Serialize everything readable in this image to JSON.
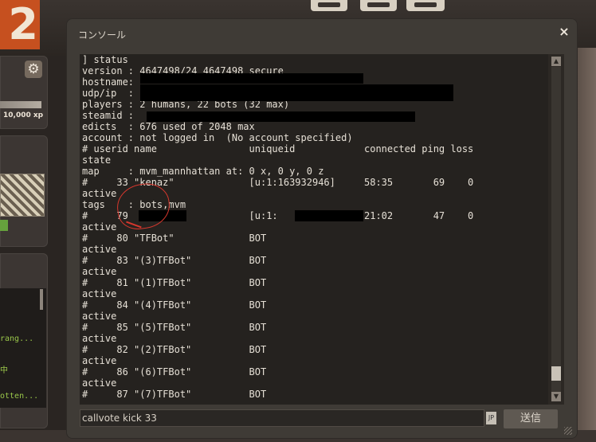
{
  "background": {
    "logo_text": "2",
    "xp_label": "10,000 xp",
    "gear_glyph": "⚙",
    "chat_lines": [
      "rang...",
      "中",
      "otten..."
    ]
  },
  "console": {
    "title": "コンソール",
    "close_glyph": "×",
    "lines": [
      "] status",
      "version : 4647498/24 4647498 secure",
      "hostname:",
      "udp/ip  :",
      "players : 2 humans, 22 bots (32 max)",
      "steamid :",
      "edicts  : 676 used of 2048 max",
      "account : not logged in  (No account specified)",
      "# userid name                uniqueid            connected ping loss",
      "state",
      "map     : mvm_mannhattan at: 0 x, 0 y, 0 z",
      "#     33 \"kenaz\"             [u:1:163932946]     58:35       69    0",
      "active",
      "tags    : bots,mvm",
      "#     79                     [u:1:               21:02       47    0",
      "active",
      "#     80 \"TFBot\"             BOT",
      "active",
      "#     83 \"(3)TFBot\"          BOT",
      "active",
      "#     81 \"(1)TFBot\"          BOT",
      "active",
      "#     84 \"(4)TFBot\"          BOT",
      "active",
      "#     85 \"(5)TFBot\"          BOT",
      "active",
      "#     82 \"(2)TFBot\"          BOT",
      "active",
      "#     86 \"(6)TFBot\"          BOT",
      "active",
      "#     87 \"(7)TFBot\"          BOT"
    ],
    "input_value": "callvote kick 33",
    "ime_indicator": "JP",
    "send_label": "送信",
    "scroll_up": "▲",
    "scroll_down": "▼"
  }
}
